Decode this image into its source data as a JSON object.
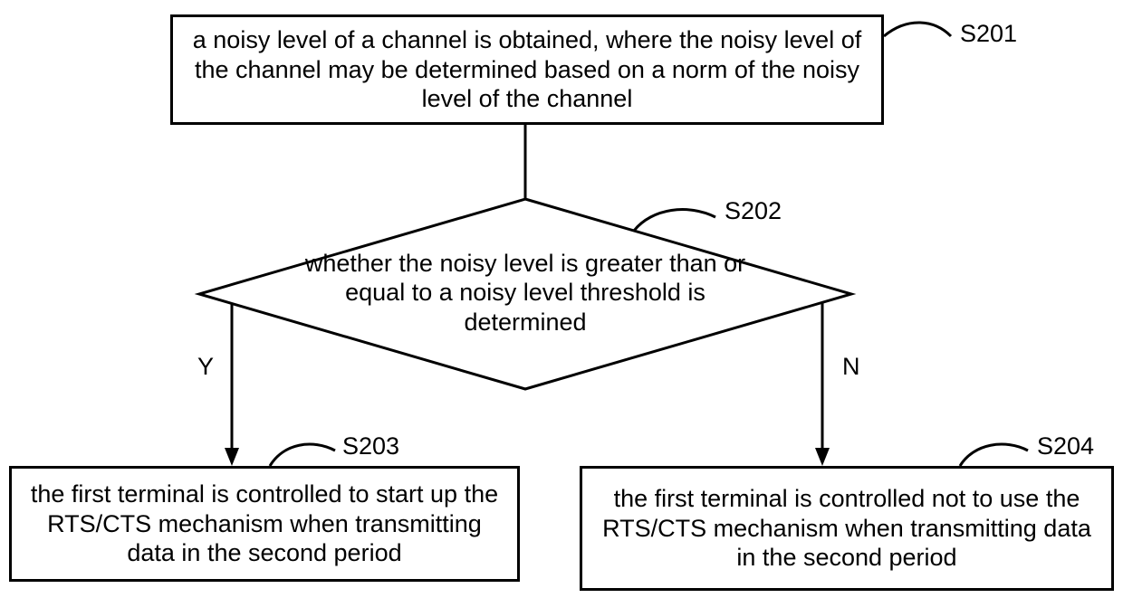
{
  "steps": {
    "s201": {
      "ref": "S201",
      "text": "a noisy level of a channel is obtained, where the noisy level of the channel may be determined based on a norm of the noisy level of the channel"
    },
    "s202": {
      "ref": "S202",
      "text": "whether the noisy level is greater than or equal to a noisy level threshold is determined"
    },
    "s203": {
      "ref": "S203",
      "text": "the first terminal is controlled to start up the RTS/CTS mechanism when transmitting data in the second period"
    },
    "s204": {
      "ref": "S204",
      "text": "the first terminal is controlled not to use the RTS/CTS mechanism when transmitting data in the second period"
    }
  },
  "edges": {
    "yes": "Y",
    "no": "N"
  },
  "chart_data": {
    "type": "flowchart",
    "nodes": [
      {
        "id": "S201",
        "shape": "rect",
        "text": "a noisy level of a channel is obtained, where the noisy level of the channel may be determined based on a norm of the noisy level of the channel"
      },
      {
        "id": "S202",
        "shape": "diamond",
        "text": "whether the noisy level is greater than or equal to a noisy level threshold is determined"
      },
      {
        "id": "S203",
        "shape": "rect",
        "text": "the first terminal is controlled to start up the RTS/CTS mechanism when transmitting data in the second period"
      },
      {
        "id": "S204",
        "shape": "rect",
        "text": "the first terminal is controlled not to use the RTS/CTS mechanism when transmitting data in the second period"
      }
    ],
    "edges": [
      {
        "from": "S201",
        "to": "S202",
        "label": ""
      },
      {
        "from": "S202",
        "to": "S203",
        "label": "Y"
      },
      {
        "from": "S202",
        "to": "S204",
        "label": "N"
      }
    ]
  }
}
